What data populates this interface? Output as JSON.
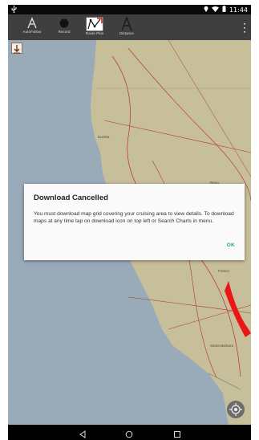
{
  "status": {
    "left_icon": "usb-icon",
    "time": "11:44"
  },
  "toolbar": {
    "tools": [
      {
        "label": "AutoFollow",
        "icon": "compass-arrow-icon"
      },
      {
        "label": "Record",
        "icon": "record-dot-icon"
      },
      {
        "label": "Route Plan",
        "icon": "route-plan-icon"
      },
      {
        "label": "Distance",
        "icon": "divider-compass-icon"
      }
    ],
    "menu_glyph": "⋮"
  },
  "map": {
    "towns": [
      "Eureka",
      "Reno",
      "Fresno",
      "Santa Barbara"
    ],
    "colors": {
      "sea": "#a7b9c9",
      "land": "#d8cfa8",
      "roads": "#c0392b",
      "arrow": "#ff1a1a"
    }
  },
  "dialog": {
    "title": "Download Cancelled",
    "message": "You must download map grid covering your cruising area to view details. To download maps at any time tap on download icon on top left or Search Charts in menu.",
    "ok_label": "OK"
  },
  "nav": {
    "back_glyph": "◁",
    "home_glyph": "○",
    "recents_glyph": "□"
  }
}
